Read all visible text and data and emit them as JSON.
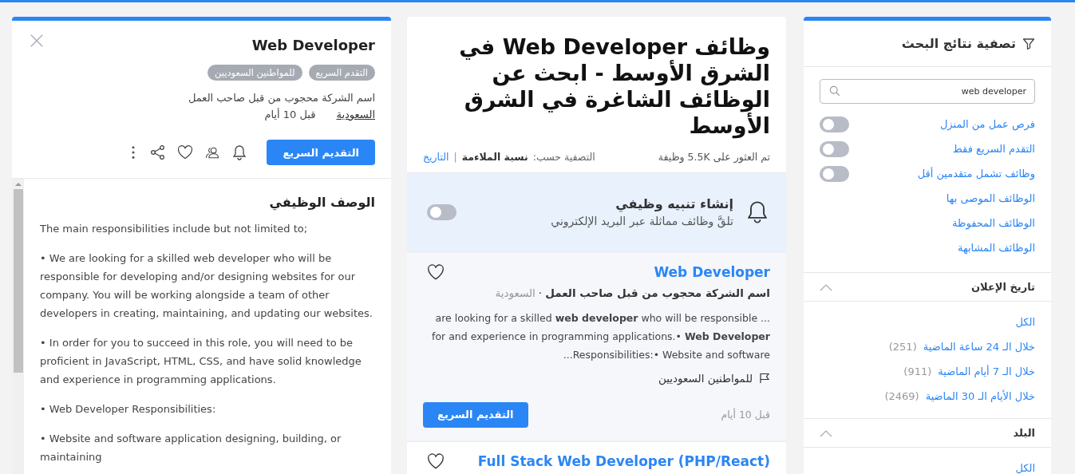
{
  "detail": {
    "title": "Web Developer",
    "tags": [
      "التقدم السريع",
      "للمواطنين السعوديين"
    ],
    "company": "اسم الشركة محجوب من قبل صاحب العمل",
    "country": "السعودية",
    "posted": "قبل 10 أيام",
    "apply_button": "التقديم السريع",
    "description_heading": "الوصف الوظيفي",
    "description": [
      "The main responsibilities include but not limited to;",
      "• We are looking for a skilled web developer who will be responsible for developing and/or designing websites for our company. You will be working alongside a team of other developers in creating, maintaining, and updating our websites.",
      "• In order for you to succeed in this role, you will need to be proficient in JavaScript, HTML, CSS, and have solid knowledge and experience in programming applications.",
      "• Web Developer Responsibilities:",
      "• Website and software application designing, building, or maintaining"
    ]
  },
  "results": {
    "heading": "وظائف Web Developer في الشرق الأوسط - ابحث عن الوظائف الشاغرة في الشرق الأوسط",
    "count": "تم العثور على 5.5K وظيفة",
    "sort_label": "التصفية حسب:",
    "sort_separator": "|",
    "sort_options": [
      {
        "label": "نسبة الملاءمة",
        "selected": true
      },
      {
        "label": "التاريخ",
        "selected": false
      }
    ],
    "alert": {
      "title": "إنشاء تنبيه وظيفي",
      "subtitle": "تلقَّ وظائف مماثلة عبر البريد الإلكتروني",
      "on": false
    },
    "jobs": [
      {
        "title": "Web Developer",
        "company": "اسم الشركة محجوب من قبل صاحب العمل",
        "separator": "·",
        "country": "السعودية",
        "snippet": "... are looking for a skilled **web developer** who will be responsible for and experience in programming applications.• **Web Developer** Responsibilities:• Website and software...",
        "tag": "للمواطنين السعوديين",
        "posted": "قبل 10 أيام",
        "apply_button": "التقديم السريع",
        "saved": false
      },
      {
        "title": "Full Stack Web Developer (PHP/React)",
        "saved": false
      }
    ]
  },
  "filters": {
    "title": "تصفية نتائج البحث",
    "search": {
      "value": "web developer"
    },
    "toggles": [
      {
        "label": "فرص عمل من المنزل",
        "on": false
      },
      {
        "label": "التقدم السريع فقط",
        "on": false
      },
      {
        "label": "وظائف تشمل متقدمين أقل",
        "on": false
      }
    ],
    "links": [
      "الوظائف الموصى بها",
      "الوظائف المحفوظة",
      "الوظائف المشابهة"
    ],
    "sections": [
      {
        "title": "تاريخ الإعلان",
        "expanded": true,
        "options": [
          {
            "label": "الكل"
          },
          {
            "label": "خلال الـ 24 ساعة الماضية",
            "count": "(251)"
          },
          {
            "label": "خلال الـ 7 أيام الماضية",
            "count": "(911)"
          },
          {
            "label": "خلال الأيام الـ 30 الماضية",
            "count": "(2469)"
          }
        ]
      },
      {
        "title": "البلد",
        "expanded": true,
        "options": [
          {
            "label": "الكل"
          }
        ]
      }
    ]
  }
}
